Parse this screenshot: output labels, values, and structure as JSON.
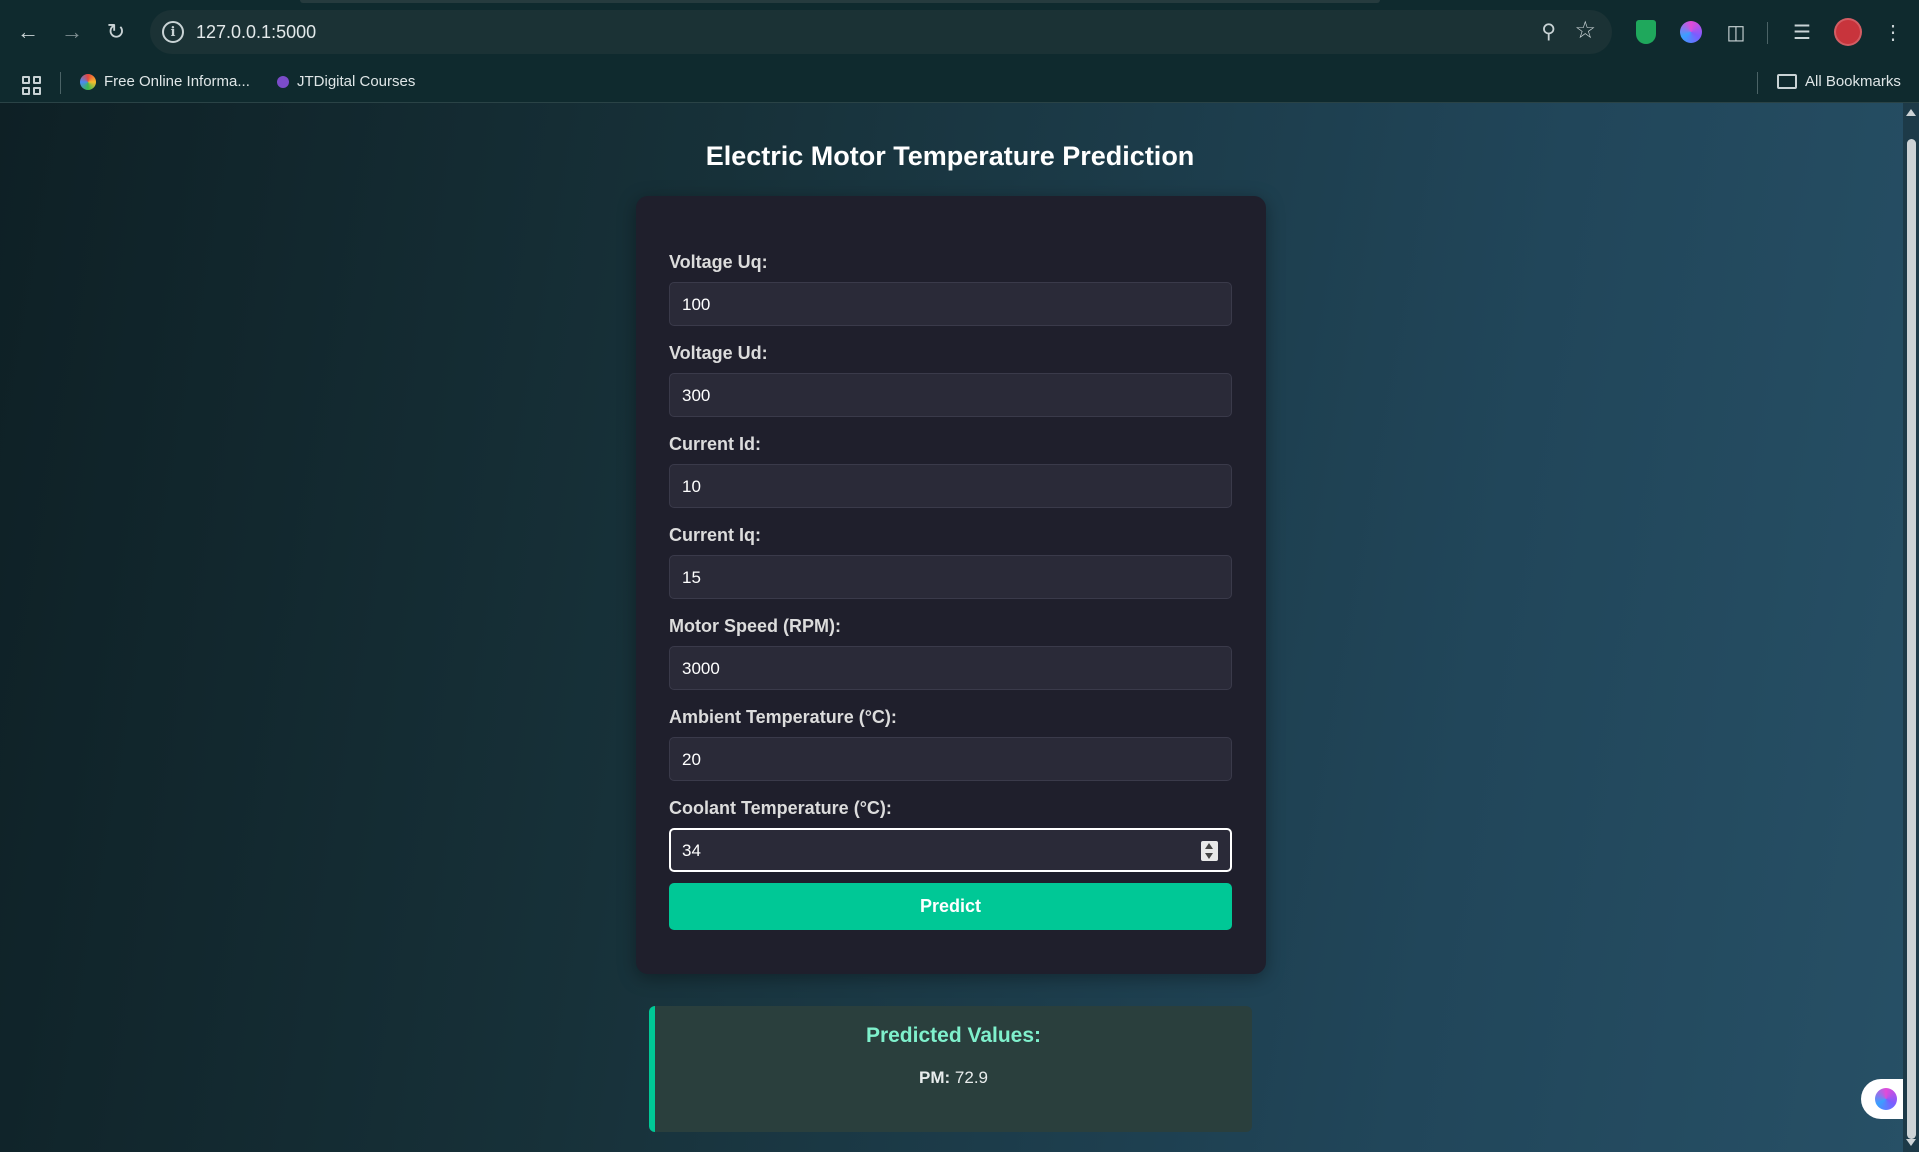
{
  "browser": {
    "url": "127.0.0.1:5000",
    "bookmarks": [
      {
        "label": "Free Online Informa..."
      },
      {
        "label": "JTDigital Courses"
      }
    ],
    "all_bookmarks_label": "All Bookmarks"
  },
  "page": {
    "title": "Electric Motor Temperature Prediction",
    "fields": [
      {
        "label": "Voltage Uq:",
        "value": "100"
      },
      {
        "label": "Voltage Ud:",
        "value": "300"
      },
      {
        "label": "Current Id:",
        "value": "10"
      },
      {
        "label": "Current Iq:",
        "value": "15"
      },
      {
        "label": "Motor Speed (RPM):",
        "value": "3000"
      },
      {
        "label": "Ambient Temperature (°C):",
        "value": "20"
      },
      {
        "label": "Coolant Temperature (°C):",
        "value": "34"
      }
    ],
    "predict_label": "Predict",
    "result": {
      "title": "Predicted Values:",
      "key": "PM:",
      "value": "72.9"
    }
  },
  "colors": {
    "accent": "#00c896",
    "card_bg": "#1f1f2c",
    "result_title": "#7ff0cc"
  }
}
